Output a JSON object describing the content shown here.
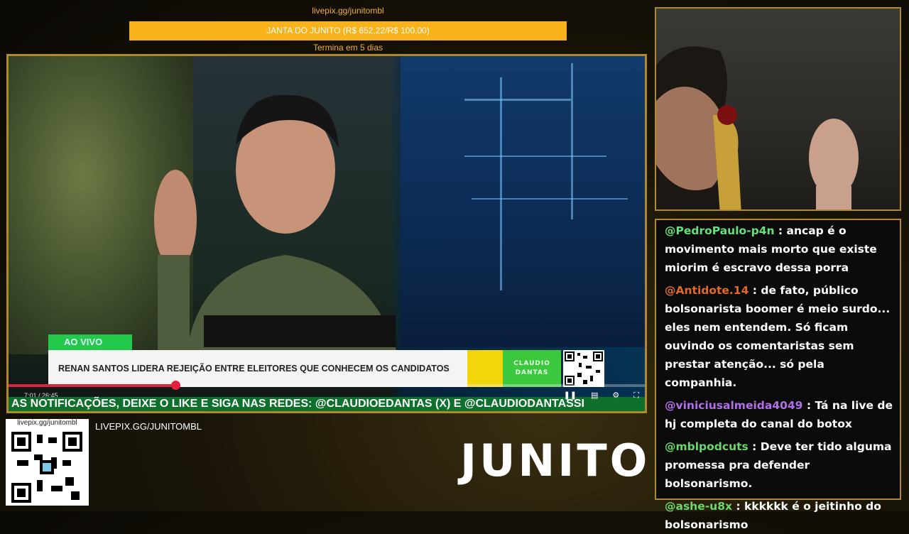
{
  "goal": {
    "url": "livepix.gg/junitombl",
    "title": "JANTA DO JUNITO (R$ 652,22/R$ 100,00)",
    "progress_percent": 100,
    "ends_in": "Termina em 5 dias"
  },
  "video": {
    "live_badge": "AO VIVO",
    "headline": "RENAN SANTOS LIDERA REJEIÇÃO ENTRE ELEITORES QUE CONHECEM OS CANDIDATOS",
    "channel_logo": "CLAUDIO DANTAS",
    "time": "7:01 / 26:45",
    "progress_fraction": 0.262,
    "ticker": "AS NOTIFICAÇÕES, DEIXE O LIKE E SIGA NAS REDES: @CLAUDIOEDANTAS (X) E @CLAUDIODANTASSI",
    "accent": "#e2223a"
  },
  "chat": {
    "messages": [
      {
        "user": "@PedroPaulo-p4n",
        "color": "#66e07a",
        "text": " : ancap é o movimento mais morto que existe miorim é escravo dessa porra"
      },
      {
        "user": "@Antidote.14",
        "color": "#e06a2a",
        "text": " : de fato, público bolsonarista boomer é meio surdo... eles nem entendem. Só ficam ouvindo os comentaristas sem prestar atenção... só pela companhia."
      },
      {
        "user": "@viniciusalmeida4049",
        "color": "#b070e8",
        "text": " : Tá na live de hj completa do canal do botox"
      },
      {
        "user": "@mblpodcuts",
        "color": "#6ad86a",
        "text": " : Deve ter tido alguma promessa pra defender bolsonarismo."
      },
      {
        "user": "@ashe-u8x",
        "color": "#6ad86a",
        "text": " : kkkkkk é o jeitinho do bolsonarismo"
      }
    ]
  },
  "footer": {
    "qr_caption": "livepix.gg/junitombl",
    "livepix_text": "LIVEPIX.GG/JUNITOMBL",
    "logo_text": "JUNITO"
  }
}
